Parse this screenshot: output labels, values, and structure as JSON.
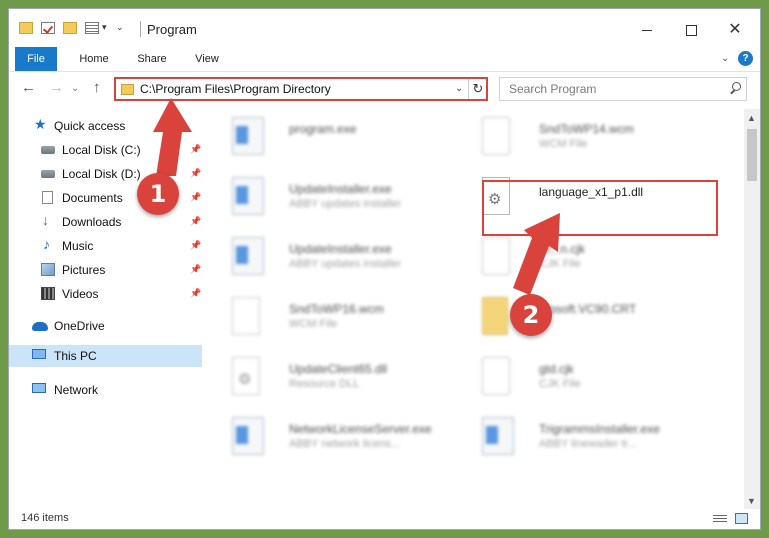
{
  "window": {
    "title": "Program",
    "controls": {
      "minimize": "—",
      "maximize": "□",
      "close": "✕"
    }
  },
  "ribbon": {
    "tabs": [
      {
        "label": "File"
      },
      {
        "label": "Home"
      },
      {
        "label": "Share"
      },
      {
        "label": "View"
      }
    ],
    "help": "?"
  },
  "nav": {
    "back": "←",
    "forward": "→",
    "up": "↑",
    "address": "C:\\Program Files\\Program Directory",
    "refresh": "↻",
    "dropdown": "⌄"
  },
  "search": {
    "placeholder": "Search Program"
  },
  "sidebar": {
    "items": [
      {
        "label": "Quick access",
        "icon": "star-icon"
      },
      {
        "label": "Local Disk (C:)",
        "icon": "drive-icon",
        "pinned": true
      },
      {
        "label": "Local Disk (D:)",
        "icon": "drive-icon",
        "pinned": true
      },
      {
        "label": "Documents",
        "icon": "document-icon",
        "pinned": true
      },
      {
        "label": "Downloads",
        "icon": "download-icon",
        "pinned": true
      },
      {
        "label": "Music",
        "icon": "music-icon",
        "pinned": true
      },
      {
        "label": "Pictures",
        "icon": "pictures-icon",
        "pinned": true
      },
      {
        "label": "Videos",
        "icon": "videos-icon",
        "pinned": true
      },
      {
        "label": "OneDrive",
        "icon": "cloud-icon"
      },
      {
        "label": "This PC",
        "icon": "computer-icon",
        "selected": true
      },
      {
        "label": "Network",
        "icon": "network-icon"
      }
    ]
  },
  "files": [
    {
      "name": "program.exe",
      "type": "",
      "kind": "exe"
    },
    {
      "name": "SndToWP14.wcm",
      "type": "WCM File",
      "kind": "doc"
    },
    {
      "name": "UpdateInstaller.exe",
      "type": "ABBY updates installer",
      "kind": "exe"
    },
    {
      "name": "language_x1_p1.dll",
      "type": "",
      "kind": "gear",
      "highlighted": true
    },
    {
      "name": "UpdateInstaller.exe",
      "type": "ABBY updates installer",
      "kind": "exe"
    },
    {
      "name": "Kr...n.cjk",
      "type": "CJK File",
      "kind": "doc"
    },
    {
      "name": "SndToWP16.wcm",
      "type": "WCM File",
      "kind": "doc"
    },
    {
      "name": "...osoft.VC90.CRT",
      "type": "",
      "kind": "folder"
    },
    {
      "name": "UpdateClient65.dll",
      "type": "Resource DLL",
      "kind": "gear"
    },
    {
      "name": "gtd.cjk",
      "type": "CJK File",
      "kind": "doc"
    },
    {
      "name": "NetworkLicenseServer.exe",
      "type": "ABBY network licens...",
      "kind": "exe"
    },
    {
      "name": "TrigrammsInstaller.exe",
      "type": "ABBY linewader tr...",
      "kind": "exe"
    }
  ],
  "status": {
    "items": "146 items"
  },
  "annotations": {
    "step1": "1",
    "step2": "2"
  },
  "colors": {
    "accent": "#1979ca",
    "highlight": "#d9433c",
    "selected": "#cce4f7"
  }
}
